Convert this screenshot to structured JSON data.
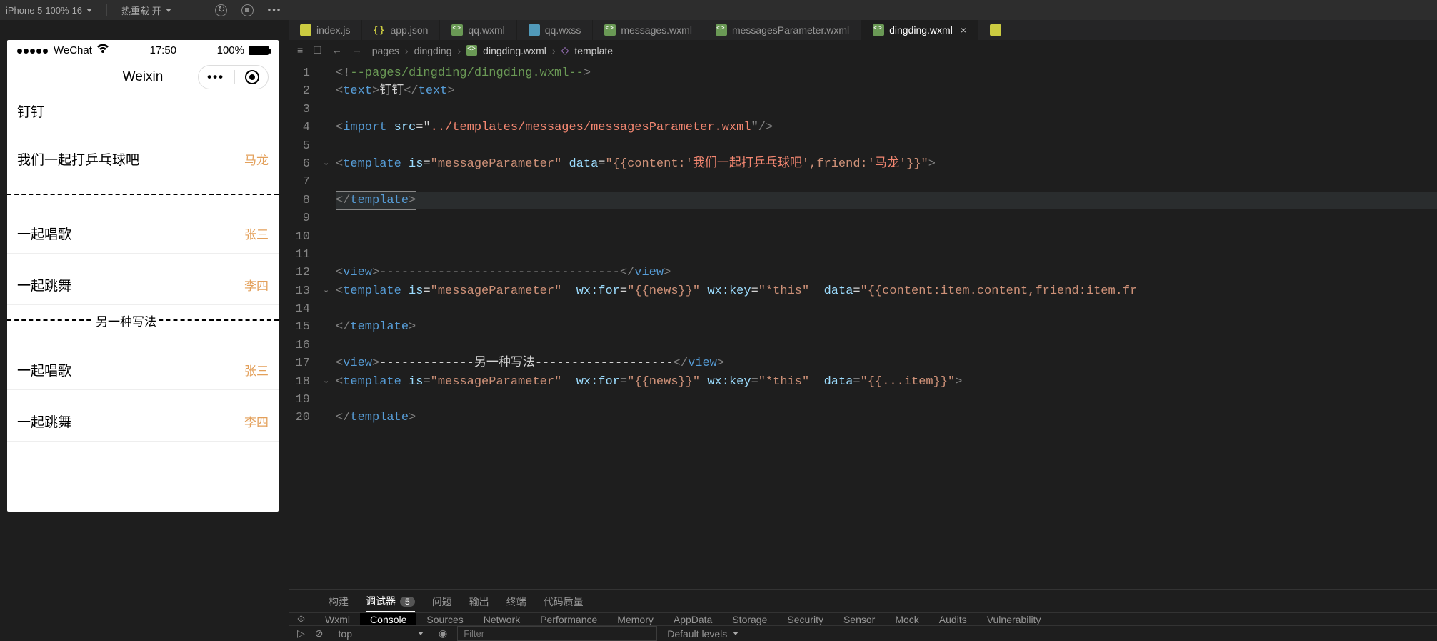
{
  "topBar": {
    "device": "iPhone 5",
    "zoom": "100%",
    "fontSize": "16",
    "hotReload": "热重载 开"
  },
  "editorTabs": [
    {
      "icon": "js",
      "label": "index.js",
      "active": false
    },
    {
      "icon": "json",
      "label": "app.json",
      "active": false
    },
    {
      "icon": "wxml",
      "label": "qq.wxml",
      "active": false
    },
    {
      "icon": "wxss",
      "label": "qq.wxss",
      "active": false
    },
    {
      "icon": "wxml",
      "label": "messages.wxml",
      "active": false
    },
    {
      "icon": "wxml",
      "label": "messagesParameter.wxml",
      "active": false
    },
    {
      "icon": "wxml",
      "label": "dingding.wxml",
      "active": true
    },
    {
      "icon": "js",
      "label": "",
      "active": false
    }
  ],
  "breadcrumb": {
    "parts": [
      "pages",
      "dingding",
      "dingding.wxml",
      "template"
    ]
  },
  "code": {
    "lines": [
      {
        "n": 1,
        "fold": "",
        "html": "<span class='pnc'>&lt;!</span><span class='cmt'>--pages/dingding/dingding.wxml--</span><span class='pnc'>&gt;</span>"
      },
      {
        "n": 2,
        "fold": "",
        "html": "<span class='pnc'>&lt;</span><span class='tg'>text</span><span class='pnc'>&gt;</span><span class='txt'>钉钉</span><span class='pnc'>&lt;/</span><span class='tg'>text</span><span class='pnc'>&gt;</span>"
      },
      {
        "n": 3,
        "fold": "",
        "html": ""
      },
      {
        "n": 4,
        "fold": "",
        "html": "<span class='pnc'>&lt;</span><span class='tg'>import</span> <span class='attr'>src</span><span class='txt'>=</span><span class='txt'>\"</span><span class='pth'>../templates/messages/messagesParameter.wxml</span><span class='txt'>\"</span><span class='pnc'>/&gt;</span>"
      },
      {
        "n": 5,
        "fold": "",
        "html": ""
      },
      {
        "n": 6,
        "fold": "⌄",
        "html": "<span class='pnc'>&lt;</span><span class='tg'>template</span> <span class='attr'>is</span><span class='txt'>=</span><span class='str'>\"messageParameter\"</span> <span class='attr'>data</span><span class='txt'>=</span><span class='str'>\"{{content:'</span><span class='cn'>我们一起打乒乓球吧</span><span class='str'>',friend:'</span><span class='cn'>马龙</span><span class='str'>'}}\"</span><span class='pnc'>&gt;</span>"
      },
      {
        "n": 7,
        "fold": "",
        "html": ""
      },
      {
        "n": 8,
        "fold": "",
        "hl": true,
        "html": "<span class='cursor-box'><span class='pnc'>&lt;/</span><span class='tg'>template</span><span class='pnc'>&gt;</span></span>"
      },
      {
        "n": 9,
        "fold": "",
        "html": ""
      },
      {
        "n": 10,
        "fold": "",
        "html": ""
      },
      {
        "n": 11,
        "fold": "",
        "html": ""
      },
      {
        "n": 12,
        "fold": "",
        "html": "<span class='pnc'>&lt;</span><span class='tg'>view</span><span class='pnc'>&gt;</span><span class='txt'>---------------------------------</span><span class='pnc'>&lt;/</span><span class='tg'>view</span><span class='pnc'>&gt;</span>"
      },
      {
        "n": 13,
        "fold": "⌄",
        "html": "<span class='pnc'>&lt;</span><span class='tg'>template</span> <span class='attr'>is</span><span class='txt'>=</span><span class='str'>\"messageParameter\"</span>  <span class='attr'>wx:for</span><span class='txt'>=</span><span class='str'>\"{{news}}\"</span> <span class='attr'>wx:key</span><span class='txt'>=</span><span class='str'>\"*this\"</span>  <span class='attr'>data</span><span class='txt'>=</span><span class='str'>\"{{content:item.content,friend:item.fr</span>"
      },
      {
        "n": 14,
        "fold": "",
        "html": ""
      },
      {
        "n": 15,
        "fold": "",
        "html": "<span class='pnc'>&lt;/</span><span class='tg'>template</span><span class='pnc'>&gt;</span>"
      },
      {
        "n": 16,
        "fold": "",
        "html": ""
      },
      {
        "n": 17,
        "fold": "",
        "html": "<span class='pnc'>&lt;</span><span class='tg'>view</span><span class='pnc'>&gt;</span><span class='txt'>-------------另一种写法-------------------</span><span class='pnc'>&lt;/</span><span class='tg'>view</span><span class='pnc'>&gt;</span>"
      },
      {
        "n": 18,
        "fold": "⌄",
        "html": "<span class='pnc'>&lt;</span><span class='tg'>template</span> <span class='attr'>is</span><span class='txt'>=</span><span class='str'>\"messageParameter\"</span>  <span class='attr'>wx:for</span><span class='txt'>=</span><span class='str'>\"{{news}}\"</span> <span class='attr'>wx:key</span><span class='txt'>=</span><span class='str'>\"*this\"</span>  <span class='attr'>data</span><span class='txt'>=</span><span class='str'>\"{{...item}}\"</span><span class='pnc'>&gt;</span>"
      },
      {
        "n": 19,
        "fold": "",
        "html": ""
      },
      {
        "n": 20,
        "fold": "",
        "html": "<span class='pnc'>&lt;/</span><span class='tg'>template</span><span class='pnc'>&gt;</span>"
      }
    ]
  },
  "simulator": {
    "carrier": "WeChat",
    "time": "17:50",
    "battery": "100%",
    "navTitle": "Weixin",
    "pageTitle": "钉钉",
    "messages1": [
      {
        "content": "我们一起打乒乓球吧",
        "friend": "马龙"
      }
    ],
    "messages2": [
      {
        "content": "一起唱歌",
        "friend": "张三"
      },
      {
        "content": "一起跳舞",
        "friend": "李四"
      }
    ],
    "altLabel": "另一种写法",
    "messages3": [
      {
        "content": "一起唱歌",
        "friend": "张三"
      },
      {
        "content": "一起跳舞",
        "friend": "李四"
      }
    ]
  },
  "bottomTabs": {
    "build": "构建",
    "debugger": "调试器",
    "debuggerCount": "5",
    "issues": "问题",
    "output": "输出",
    "terminal": "终端",
    "quality": "代码质量"
  },
  "devtools": {
    "tabs": [
      "Wxml",
      "Console",
      "Sources",
      "Network",
      "Performance",
      "Memory",
      "AppData",
      "Storage",
      "Security",
      "Sensor",
      "Mock",
      "Audits",
      "Vulnerability"
    ],
    "activeTab": "Console",
    "context": "top",
    "filterPlaceholder": "Filter",
    "levels": "Default levels"
  }
}
